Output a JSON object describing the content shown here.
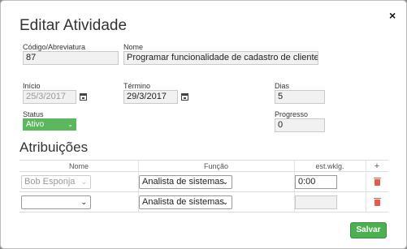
{
  "modal": {
    "title": "Editar Atividade",
    "close_symbol": "×"
  },
  "form": {
    "codigo": {
      "label": "Código/Abreviatura",
      "value": "87"
    },
    "nome": {
      "label": "Nome",
      "value": "Programar funcionalidade de cadastro de clientes."
    },
    "inicio": {
      "label": "Início",
      "value": "25/3/2017"
    },
    "termino": {
      "label": "Término",
      "value": "29/3/2017"
    },
    "dias": {
      "label": "Dias",
      "value": "5"
    },
    "status": {
      "label": "Status",
      "value": "Ativo"
    },
    "progresso": {
      "label": "Progresso",
      "value": "0"
    }
  },
  "atribuicoes": {
    "title": "Atribuições",
    "headers": {
      "nome": "Nome",
      "funcao": "Função",
      "est": "est.wklg.",
      "add": "+"
    },
    "rows": [
      {
        "nome": "Bob Esponja",
        "funcao": "Analista de sistemas",
        "est": "0:00"
      },
      {
        "nome": "",
        "funcao": "Analista de sistemas",
        "est": ""
      }
    ]
  },
  "save_label": "Salvar",
  "icons": {
    "calendar": "calendar-icon",
    "trash": "trash-icon",
    "chevron": "chevron-down-icon"
  },
  "colors": {
    "status_green": "#5cb85c",
    "save_green": "#4caf50",
    "trash_red": "#e35d4f"
  }
}
